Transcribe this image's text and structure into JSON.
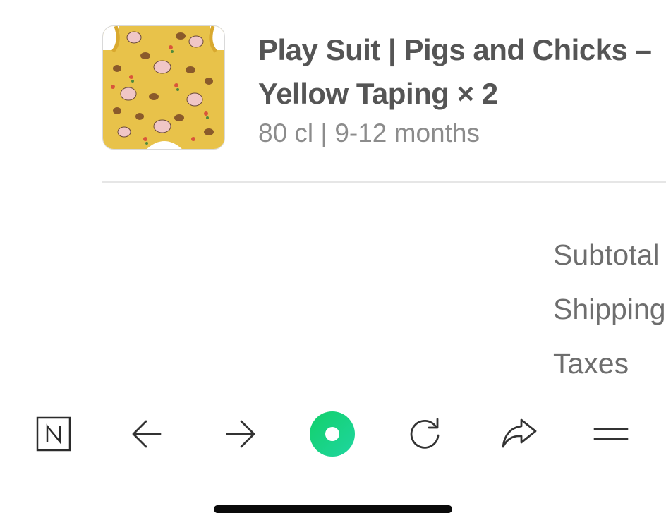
{
  "order_item": {
    "title": "Play Suit | Pigs and Chicks – Yellow Taping × 2",
    "variant": "80 cl | 9-12 months",
    "image_name": "product-thumbnail-pigs-and-chicks"
  },
  "summary": {
    "subtotal_label": "Subtotal",
    "shipping_label": "Shipping",
    "taxes_label": "Taxes"
  },
  "toolbar": {
    "buttons": [
      {
        "name": "app-logo-button",
        "icon": "n-logo-icon"
      },
      {
        "name": "back-button",
        "icon": "arrow-left-icon"
      },
      {
        "name": "forward-button",
        "icon": "arrow-right-icon"
      },
      {
        "name": "main-action-button",
        "icon": "green-ring-icon"
      },
      {
        "name": "reload-button",
        "icon": "reload-icon"
      },
      {
        "name": "share-button",
        "icon": "share-arrow-icon"
      },
      {
        "name": "menu-button",
        "icon": "hamburger-icon"
      }
    ]
  },
  "colors": {
    "title_text": "#555555",
    "muted_text": "#8c8c8c",
    "accent_green": "#19d47a",
    "thumbnail_background": "#e8c24a"
  }
}
